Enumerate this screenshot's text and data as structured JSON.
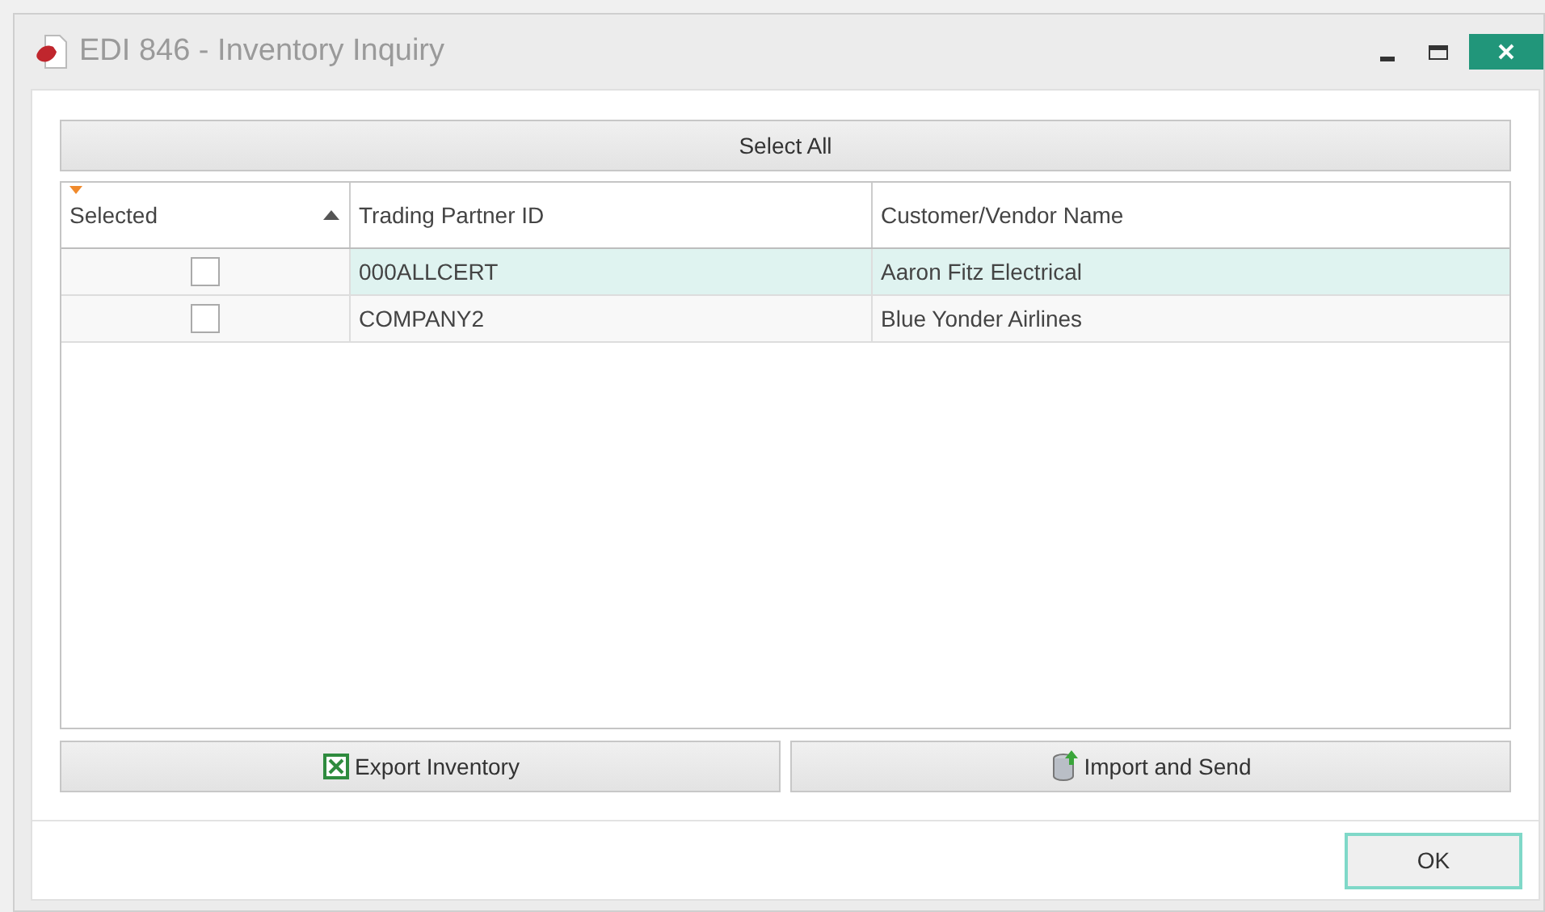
{
  "window": {
    "title": "EDI 846 - Inventory Inquiry"
  },
  "select_all_button": "Select All",
  "table": {
    "columns": [
      {
        "label": "Selected",
        "sorted": true
      },
      {
        "label": "Trading Partner ID",
        "sorted": false
      },
      {
        "label": "Customer/Vendor Name",
        "sorted": false
      }
    ],
    "rows": [
      {
        "checked": false,
        "selected": true,
        "partner_id": "000ALLCERT",
        "name": "Aaron Fitz Electrical"
      },
      {
        "checked": false,
        "selected": false,
        "partner_id": "COMPANY2",
        "name": "Blue Yonder Airlines"
      }
    ]
  },
  "action_buttons": [
    {
      "kind": "excel",
      "label": "Export Inventory"
    },
    {
      "kind": "database",
      "label": "Import and Send"
    }
  ],
  "ok_button": "OK"
}
